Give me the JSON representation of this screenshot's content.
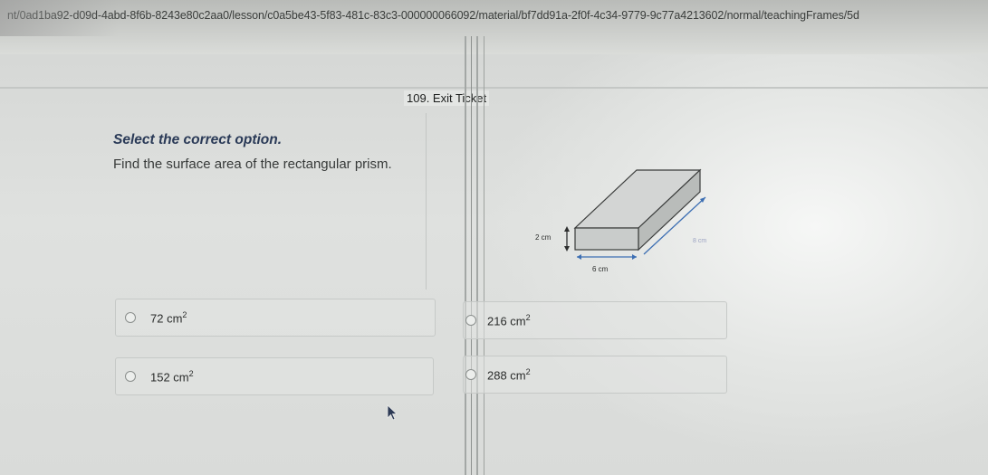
{
  "browser": {
    "url": "nt/0ad1ba92-d09d-4abd-8f6b-8243e80c2aa0/lesson/c0a5be43-5f83-481c-83c3-000000066092/material/bf7dd91a-2f0f-4c34-9779-9c77a4213602/normal/teachingFrames/5d"
  },
  "lesson": {
    "title": "109. Exit Ticket"
  },
  "question": {
    "instruction": "Select the correct option.",
    "text": "Find the surface area of the rectangular prism."
  },
  "figure": {
    "height_label": "2 cm",
    "width_label": "6 cm",
    "depth_label": "8 cm",
    "arrow_color": "#3d6fb3"
  },
  "options": [
    {
      "value": "72 cm",
      "unit_power": "2"
    },
    {
      "value": "152 cm",
      "unit_power": "2"
    },
    {
      "value": "216 cm",
      "unit_power": "2"
    },
    {
      "value": "288 cm",
      "unit_power": "2"
    }
  ]
}
